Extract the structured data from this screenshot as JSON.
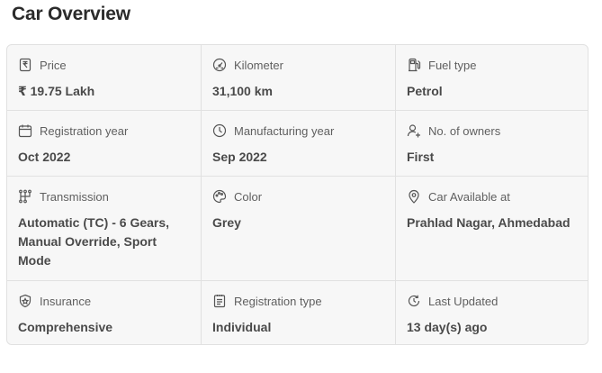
{
  "section_title": "Car Overview",
  "items": [
    {
      "label": "Price",
      "value": "₹ 19.75 Lakh",
      "icon": "price-tag-icon"
    },
    {
      "label": "Kilometer",
      "value": "31,100 km",
      "icon": "speedometer-icon"
    },
    {
      "label": "Fuel type",
      "value": "Petrol",
      "icon": "fuel-pump-icon"
    },
    {
      "label": "Registration year",
      "value": "Oct 2022",
      "icon": "calendar-icon"
    },
    {
      "label": "Manufacturing year",
      "value": "Sep 2022",
      "icon": "clock-icon"
    },
    {
      "label": "No. of owners",
      "value": "First",
      "icon": "owner-icon"
    },
    {
      "label": "Transmission",
      "value": "Automatic (TC) - 6 Gears, Manual Override, Sport Mode",
      "icon": "gear-shift-icon"
    },
    {
      "label": "Color",
      "value": "Grey",
      "icon": "palette-icon"
    },
    {
      "label": "Car Available at",
      "value": "Prahlad Nagar, Ahmedabad",
      "icon": "location-pin-icon"
    },
    {
      "label": "Insurance",
      "value": "Comprehensive",
      "icon": "shield-icon"
    },
    {
      "label": "Registration type",
      "value": "Individual",
      "icon": "document-icon"
    },
    {
      "label": "Last Updated",
      "value": "13 day(s) ago",
      "icon": "refresh-icon"
    }
  ]
}
